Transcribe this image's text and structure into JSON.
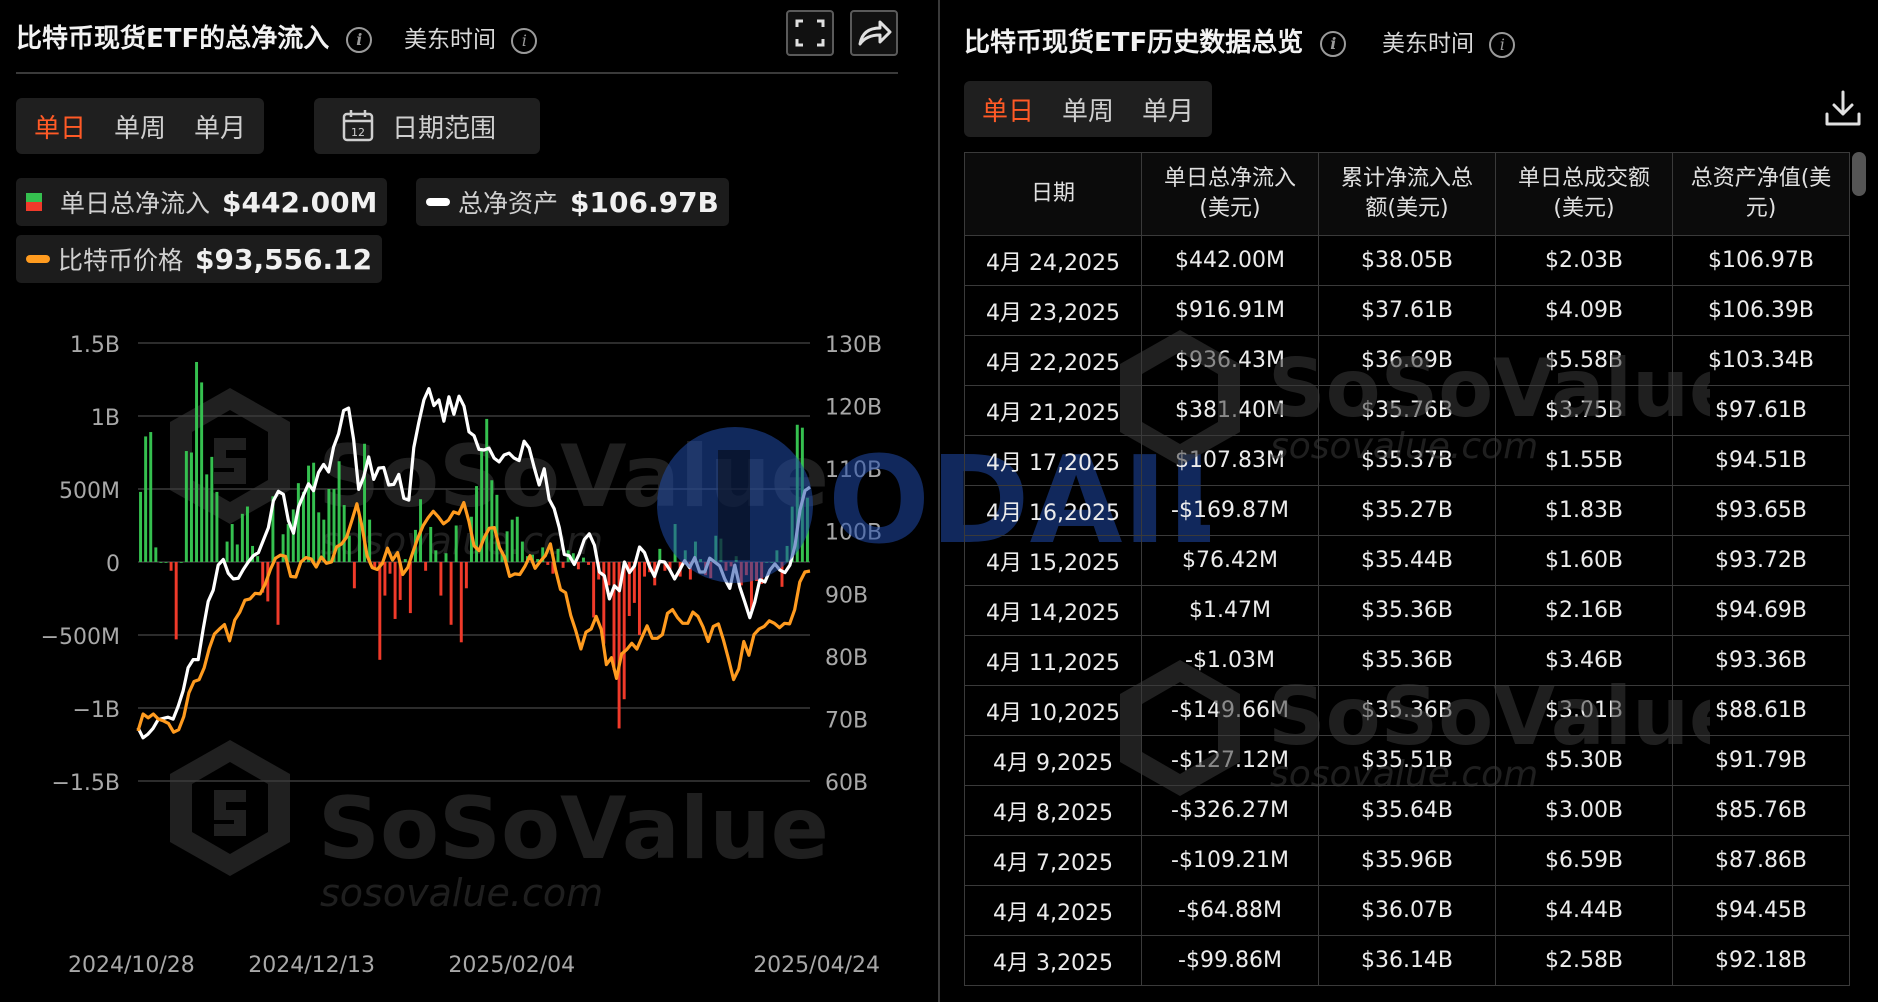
{
  "left_panel": {
    "title": "比特币现货ETF的总净流入",
    "timezone": "美东时间",
    "tabs": [
      "单日",
      "单周",
      "单月"
    ],
    "active_tab": "单日",
    "date_range_label": "日期范围",
    "calendar_day": "12",
    "stats": {
      "net_inflow_label": "单日总净流入",
      "net_inflow_value": "$442.00M",
      "total_assets_label": "总净资产",
      "total_assets_value": "$106.97B",
      "btc_price_label": "比特币价格",
      "btc_price_value": "$93,556.12"
    }
  },
  "right_panel": {
    "title": "比特币现货ETF历史数据总览",
    "timezone": "美东时间",
    "tabs": [
      "单日",
      "单周",
      "单月"
    ],
    "active_tab": "单日",
    "table": {
      "headers": [
        "日期",
        "单日总净流入(美元)",
        "累计净流入总额(美元)",
        "单日总成交额(美元)",
        "总资产净值(美元)"
      ],
      "rows": [
        [
          "4月 24,2025",
          "$442.00M",
          "$38.05B",
          "$2.03B",
          "$106.97B"
        ],
        [
          "4月 23,2025",
          "$916.91M",
          "$37.61B",
          "$4.09B",
          "$106.39B"
        ],
        [
          "4月 22,2025",
          "$936.43M",
          "$36.69B",
          "$5.58B",
          "$103.34B"
        ],
        [
          "4月 21,2025",
          "$381.40M",
          "$35.76B",
          "$3.75B",
          "$97.61B"
        ],
        [
          "4月 17,2025",
          "$107.83M",
          "$35.37B",
          "$1.55B",
          "$94.51B"
        ],
        [
          "4月 16,2025",
          "-$169.87M",
          "$35.27B",
          "$1.83B",
          "$93.65B"
        ],
        [
          "4月 15,2025",
          "$76.42M",
          "$35.44B",
          "$1.60B",
          "$93.72B"
        ],
        [
          "4月 14,2025",
          "$1.47M",
          "$35.36B",
          "$2.16B",
          "$94.69B"
        ],
        [
          "4月 11,2025",
          "-$1.03M",
          "$35.36B",
          "$3.46B",
          "$93.36B"
        ],
        [
          "4月 10,2025",
          "-$149.66M",
          "$35.36B",
          "$3.01B",
          "$88.61B"
        ],
        [
          "4月 9,2025",
          "-$127.12M",
          "$35.51B",
          "$5.30B",
          "$91.79B"
        ],
        [
          "4月 8,2025",
          "-$326.27M",
          "$35.64B",
          "$3.00B",
          "$85.76B"
        ],
        [
          "4月 7,2025",
          "-$109.21M",
          "$35.96B",
          "$6.59B",
          "$87.86B"
        ],
        [
          "4月 4,2025",
          "-$64.88M",
          "$36.07B",
          "$4.44B",
          "$94.45B"
        ],
        [
          "4月 3,2025",
          "-$99.86M",
          "$36.14B",
          "$2.58B",
          "$92.18B"
        ]
      ]
    }
  },
  "watermarks": {
    "brand": "SoSoValue",
    "site": "sosovalue.com",
    "overlay": "ODAILY"
  },
  "colors": {
    "accent": "#ff5a26",
    "inflow": "#35c04f",
    "outflow": "#f03a2a",
    "total_assets_line": "#ffffff",
    "btc_price_line": "#ff9b1f"
  },
  "icons": [
    "info-icon",
    "fullscreen-icon",
    "share-icon",
    "calendar-icon",
    "download-icon"
  ],
  "chart_data": {
    "type": "bar",
    "title": "",
    "x_tick_labels": [
      "2024/10/28",
      "2024/12/13",
      "2025/02/04",
      "2025/04/24"
    ],
    "x_start": "2024/10/28",
    "x_end": "2025/04/24",
    "left_axis": {
      "ticks": [
        "1.5B",
        "1B",
        "500M",
        "0",
        "−500M",
        "−1B",
        "−1.5B"
      ],
      "range": [
        -1.5,
        1.5
      ],
      "unit": "B"
    },
    "right_axis": {
      "ticks": [
        "130B",
        "120B",
        "110B",
        "100B",
        "90B",
        "80B",
        "70B",
        "60B"
      ],
      "range": [
        60,
        130
      ],
      "unit": "B"
    },
    "grid": true,
    "series": [
      {
        "name": "单日总净流入",
        "type": "bar",
        "unit": "B",
        "values": [
          0.48,
          0.86,
          0.89,
          0.1,
          0.0,
          0.0,
          -0.06,
          -0.53,
          0.0,
          0.76,
          0.75,
          1.37,
          1.23,
          0.6,
          0.72,
          0.48,
          0.0,
          0.14,
          0.26,
          0.12,
          0.33,
          0.38,
          0.11,
          0.04,
          -0.21,
          -0.27,
          0.45,
          -0.43,
          0.19,
          0.26,
          0.36,
          0.54,
          0.48,
          0.66,
          0.68,
          0.34,
          0.29,
          0.5,
          0.5,
          0.69,
          0.39,
          0.18,
          -0.18,
          0.32,
          0.81,
          0.29,
          -0.05,
          -0.67,
          -0.23,
          -0.08,
          -0.39,
          -0.26,
          0.02,
          -0.35,
          0.22,
          0.43,
          -0.06,
          0.24,
          0.08,
          -0.23,
          0.06,
          -0.43,
          0.25,
          -0.55,
          -0.18,
          0.31,
          0.52,
          0.78,
          0.98,
          0.56,
          0.46,
          0.07,
          0.21,
          0.29,
          0.31,
          0.14,
          0.04,
          0.05,
          0.02,
          0.1,
          -0.02,
          -0.08,
          0.09,
          -0.04,
          0.08,
          0.06,
          -0.05,
          0.03,
          -0.02,
          -0.38,
          -0.12,
          -0.56,
          -0.16,
          -0.74,
          -1.14,
          -0.94,
          -0.37,
          -0.28,
          -0.5,
          -0.1,
          -0.07,
          -0.16,
          0.09,
          -0.06,
          -0.05,
          0.26,
          -0.1,
          0.08,
          -0.12,
          0.14,
          0.02,
          -0.09,
          -0.11,
          0.18,
          0.16,
          -0.06,
          -0.03,
          0.04,
          -0.16,
          -0.09,
          -0.33,
          -0.13,
          -0.15,
          0.0,
          -0.0,
          0.08,
          -0.17,
          0.11,
          0.38,
          0.94,
          0.92,
          0.44
        ]
      },
      {
        "name": "总净资产",
        "type": "line",
        "unit": "B",
        "values": [
          68.5,
          66.9,
          67.5,
          68.4,
          69.8,
          70.0,
          70.2,
          69.9,
          71.9,
          74.4,
          78.1,
          79.4,
          79.4,
          84.3,
          88.7,
          90.5,
          94.5,
          95.4,
          93.2,
          92.3,
          92.4,
          93.8,
          95.0,
          96.0,
          96.5,
          98.5,
          100.5,
          104.8,
          106.3,
          105.8,
          101.6,
          99.6,
          103.8,
          105.7,
          107.5,
          106.4,
          109.3,
          110.6,
          109.4,
          113.4,
          115.5,
          119.2,
          119.6,
          114.6,
          106.6,
          108.6,
          111.8,
          108.2,
          110.0,
          110.1,
          107.3,
          107.4,
          109.0,
          105.2,
          104.9,
          113.3,
          117.3,
          120.9,
          122.7,
          120.0,
          120.9,
          117.5,
          121.4,
          118.6,
          121.5,
          119.9,
          115.8,
          115.2,
          113.0,
          112.9,
          113.2,
          111.6,
          111.0,
          112.1,
          112.4,
          111.6,
          111.2,
          114.3,
          113.2,
          110.1,
          107.3,
          109.9,
          105.0,
          103.5,
          100.5,
          96.2,
          96.0,
          94.6,
          96.3,
          98.6,
          99.5,
          97.7,
          93.4,
          92.8,
          89.1,
          91.2,
          90.4,
          95.0,
          93.3,
          94.4,
          97.4,
          96.5,
          94.3,
          92.7,
          95.1,
          95.0,
          93.8,
          92.3,
          93.7,
          95.2,
          94.1,
          95.7,
          93.4,
          93.4,
          95.6,
          95.0,
          94.4,
          92.3,
          90.8,
          94.5,
          91.0,
          88.6,
          86.1,
          88.6,
          92.2,
          91.8,
          93.7,
          94.7,
          93.7,
          93.3,
          94.5,
          97.6,
          103.3,
          106.4,
          106.97
        ]
      },
      {
        "name": "比特币价格",
        "type": "line",
        "unit": "B",
        "values": [
          68.0,
          70.7,
          70.1,
          70.7,
          69.9,
          69.6,
          69.2,
          67.8,
          68.2,
          70.3,
          74.1,
          75.9,
          76.2,
          78.1,
          81.2,
          83.5,
          84.3,
          85.0,
          82.4,
          85.7,
          87.0,
          88.9,
          89.1,
          90.0,
          89.9,
          91.5,
          93.8,
          95.6,
          96.1,
          95.9,
          92.7,
          92.6,
          95.0,
          95.7,
          95.5,
          94.2,
          95.8,
          94.8,
          95.0,
          97.4,
          97.9,
          99.0,
          101.6,
          104.3,
          100.7,
          96.0,
          94.1,
          93.8,
          94.8,
          97.2,
          95.3,
          96.5,
          93.0,
          94.1,
          96.6,
          98.9,
          100.8,
          102.1,
          103.1,
          102.2,
          101.1,
          101.7,
          103.0,
          102.7,
          104.5,
          101.5,
          97.6,
          96.8,
          98.9,
          100.4,
          100.5,
          97.3,
          95.8,
          92.7,
          93.1,
          93.0,
          94.3,
          96.0,
          94.0,
          95.1,
          96.0,
          97.9,
          93.8,
          90.6,
          90.1,
          86.5,
          84.0,
          81.1,
          83.8,
          84.3,
          86.3,
          84.2,
          78.6,
          79.7,
          76.4,
          80.3,
          81.0,
          82.0,
          81.1,
          83.0,
          84.8,
          82.8,
          82.8,
          83.4,
          86.8,
          87.4,
          86.1,
          85.2,
          85.2,
          87.0,
          86.3,
          84.6,
          82.3,
          84.7,
          85.1,
          82.5,
          79.5,
          76.2,
          77.9,
          82.3,
          80.1,
          83.4,
          84.3,
          84.7,
          85.6,
          85.2,
          84.5,
          85.2,
          85.1,
          87.4,
          91.8,
          93.4,
          93.56
        ]
      }
    ]
  }
}
